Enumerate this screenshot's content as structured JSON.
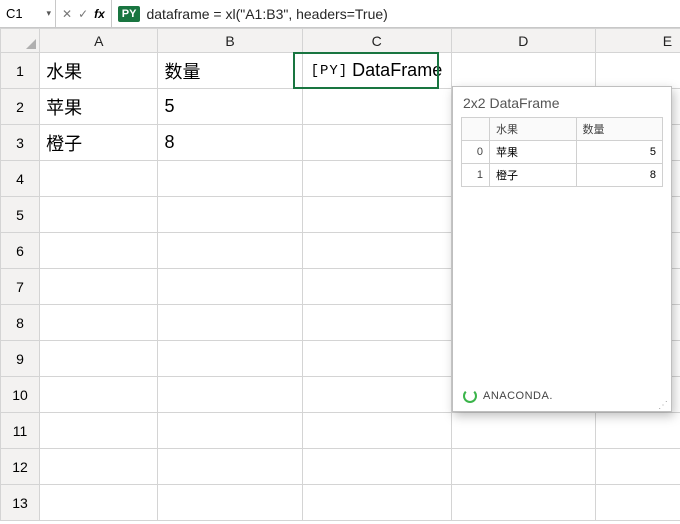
{
  "formulaBar": {
    "nameBox": "C1",
    "pyBadge": "PY",
    "formula": "dataframe = xl(\"A1:B3\", headers=True)"
  },
  "columns": [
    "A",
    "B",
    "C",
    "D",
    "E"
  ],
  "rows": [
    "1",
    "2",
    "3",
    "4",
    "5",
    "6",
    "7",
    "8",
    "9",
    "10",
    "11",
    "12",
    "13"
  ],
  "cells": {
    "A1": "水果",
    "B1": "数量",
    "A2": "苹果",
    "B2": "5",
    "A3": "橙子",
    "B3": "8"
  },
  "pyCell": {
    "badge": "[PY]",
    "label": "DataFrame"
  },
  "preview": {
    "title": "2x2 DataFrame",
    "headers": {
      "index": "",
      "col1": "水果",
      "col2": "数量"
    },
    "rows": [
      {
        "idx": "0",
        "c1": "苹果",
        "c2": "5"
      },
      {
        "idx": "1",
        "c1": "橙子",
        "c2": "8"
      }
    ],
    "footerBrand": "ANACONDA."
  }
}
